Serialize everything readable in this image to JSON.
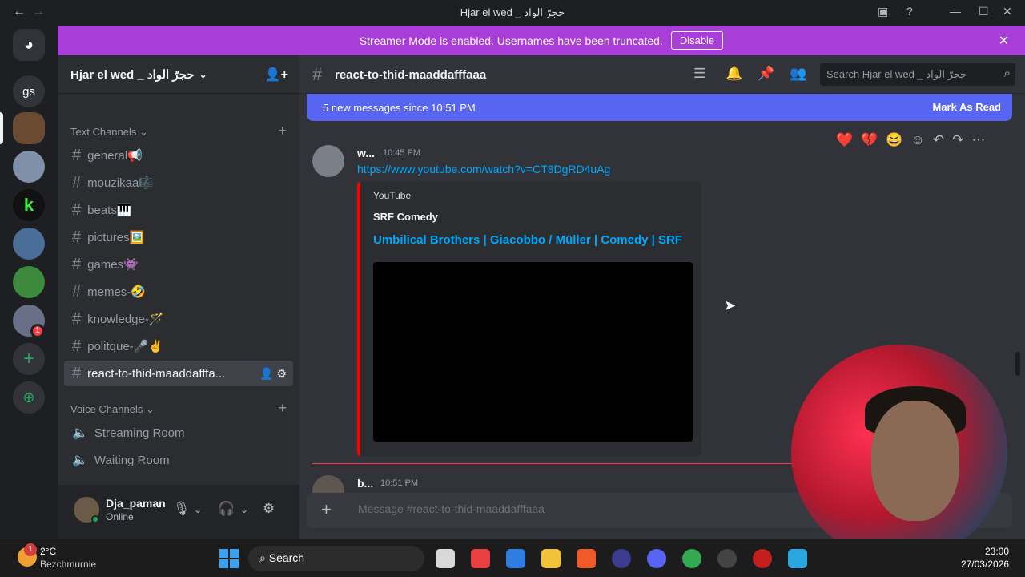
{
  "window": {
    "title": "Hjar el wed _ حجرّ الواد",
    "back": "←",
    "forward": "→"
  },
  "rail": {
    "servers": [
      {
        "label": "gs"
      }
    ],
    "badge": "1",
    "add": "+"
  },
  "banner": {
    "text": "Streamer Mode is enabled. Usernames have been truncated.",
    "button": "Disable",
    "close": "✕"
  },
  "guild": {
    "name": "Hjar el wed _ حجرّ الواد",
    "invite": "👤+"
  },
  "sidebar": {
    "text_category": "Text Channels",
    "voice_category": "Voice Channels",
    "channels": [
      {
        "name": "general📢"
      },
      {
        "name": "mouzikaa🎼"
      },
      {
        "name": "beats🎹"
      },
      {
        "name": "pictures🖼️"
      },
      {
        "name": "games👾"
      },
      {
        "name": "memes-🤣"
      },
      {
        "name": "knowledge-🪄"
      },
      {
        "name": "politque-🎤✌️"
      },
      {
        "name": "react-to-thid-maaddafffa..."
      }
    ],
    "voice": [
      {
        "name": "Streaming Room"
      },
      {
        "name": "Waiting Room"
      }
    ]
  },
  "user": {
    "name": "Dja_paman",
    "status": "Online"
  },
  "chat": {
    "channel": "react-to-thid-maaddafffaaa",
    "search_placeholder": "Search Hjar el wed _ حجرّ الواد",
    "new_messages": "5 new messages since 10:51 PM",
    "mark_read": "Mark As Read",
    "message": {
      "author": "w...",
      "time": "10:45 PM",
      "link": "https://www.youtube.com/watch?v=CT8DgRD4uAg",
      "embed": {
        "provider": "YouTube",
        "author": "SRF Comedy",
        "title": "Umbilical Brothers | Giacobbo / Müller | Comedy | SRF"
      }
    },
    "message2": {
      "author": "b...",
      "time": "10:51 PM"
    },
    "composer_placeholder": "Message #react-to-thid-maaddafffaaa",
    "reactions": [
      "❤️",
      "💔",
      "😆",
      "☺",
      "↶",
      "↷",
      "⋯"
    ]
  },
  "taskbar": {
    "weather_temp": "2°C",
    "weather_location": "Bezchmurnie",
    "weather_badge": "1",
    "search": "Search",
    "time": "23:00",
    "date": "27/03/2026"
  },
  "colors": {
    "banner": "#a93dd7",
    "blurple": "#5865f2",
    "link": "#00a8fc",
    "embed_border": "#ff0000"
  }
}
